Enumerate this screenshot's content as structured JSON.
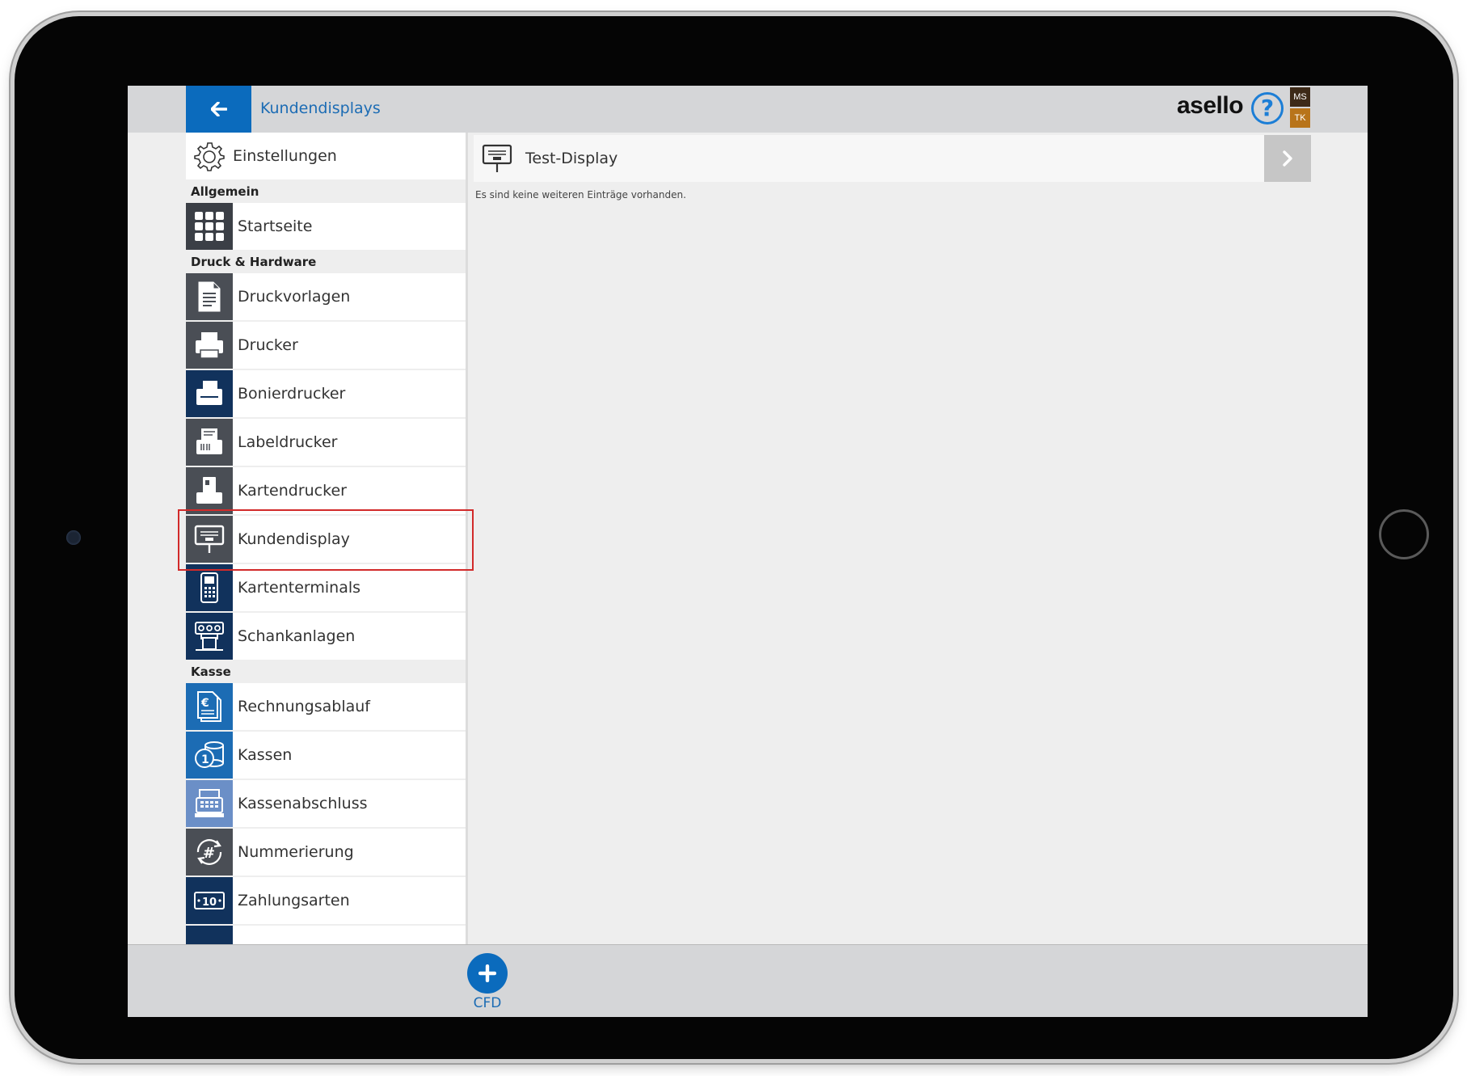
{
  "header": {
    "title": "Kundendisplays",
    "logo": "asello",
    "help": "?",
    "badges": [
      "MS",
      "TK"
    ]
  },
  "sidebar": {
    "settings_label": "Einstellungen",
    "sections": [
      {
        "title": "Allgemein",
        "items": [
          {
            "label": "Startseite",
            "icon": "grid-icon",
            "color": "#3b3f46"
          }
        ]
      },
      {
        "title": "Druck & Hardware",
        "items": [
          {
            "label": "Druckvorlagen",
            "icon": "document-icon",
            "color": "#4a4e55"
          },
          {
            "label": "Drucker",
            "icon": "printer-icon",
            "color": "#4a4e55"
          },
          {
            "label": "Bonierdrucker",
            "icon": "receipt-printer-icon",
            "color": "#11325c"
          },
          {
            "label": "Labeldrucker",
            "icon": "label-printer-icon",
            "color": "#4a4e55"
          },
          {
            "label": "Kartendrucker",
            "icon": "card-printer-icon",
            "color": "#4a4e55"
          },
          {
            "label": "Kundendisplay",
            "icon": "customer-display-icon",
            "color": "#4a4e55"
          },
          {
            "label": "Kartenterminals",
            "icon": "card-terminal-icon",
            "color": "#11325c"
          },
          {
            "label": "Schankanlagen",
            "icon": "tap-system-icon",
            "color": "#11325c"
          }
        ]
      },
      {
        "title": "Kasse",
        "items": [
          {
            "label": "Rechnungsablauf",
            "icon": "invoice-icon",
            "color": "#1c6cb4"
          },
          {
            "label": "Kassen",
            "icon": "coins-icon",
            "color": "#1c6cb4"
          },
          {
            "label": "Kassenabschluss",
            "icon": "cash-register-icon",
            "color": "#6b8fc7"
          },
          {
            "label": "Nummerierung",
            "icon": "numbering-icon",
            "color": "#4a4e55"
          },
          {
            "label": "Zahlungsarten",
            "icon": "banknote-icon",
            "color": "#11325c"
          }
        ]
      }
    ]
  },
  "main": {
    "display_label": "Test-Display",
    "empty_note": "Es sind keine weiteren Einträge vorhanden."
  },
  "footer": {
    "add_label": "CFD"
  },
  "colors": {
    "accent": "#0b6bbd",
    "highlight": "#d22a2a"
  }
}
